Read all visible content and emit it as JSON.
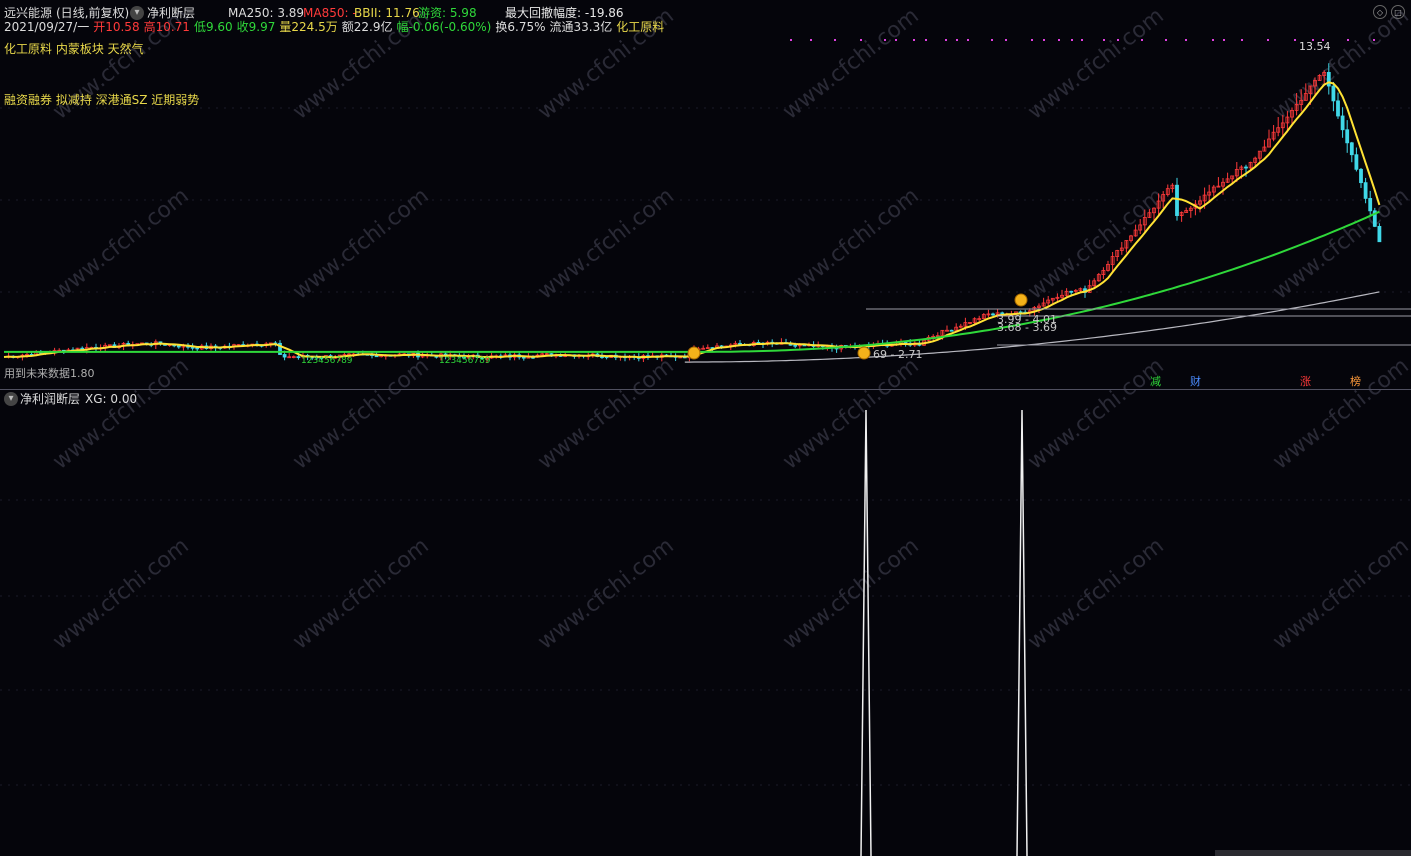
{
  "header": {
    "stock_name": "远兴能源",
    "period": "(日线,前复权)",
    "indicator_name": "净利断层",
    "ma250": "MA250: 3.89",
    "ma850": "MA850: -",
    "bbii": "BBII: 11.76",
    "youzi": "游资: 5.98",
    "max_drawdown": "最大回撤幅度: -19.86"
  },
  "info": {
    "date": "2021/09/27/一",
    "open": "开10.58",
    "high": "高10.71",
    "low": "低9.60",
    "close": "收9.97",
    "volume": "量224.5万",
    "amount": "额22.9亿",
    "change": "幅-0.06(-0.60%)",
    "turnover": "换6.75%",
    "float_cap": "流通33.3亿",
    "industry": "化工原料"
  },
  "tags": {
    "line1": "化工原料 内蒙板块 天然气",
    "line2": "融资融券 拟减持 深港通SZ 近期弱势"
  },
  "annotations": {
    "peak": "13.54",
    "level1": "3.99 - 4.01",
    "level2": "3.68 - 3.69",
    "level3": "69 - 2.71",
    "bottom_left": "用到未来数据1.80",
    "seq1": "123456789",
    "seq2": "123456789"
  },
  "flags": {
    "reduce": "减",
    "finance": "财",
    "rise": "涨",
    "rank": "榜"
  },
  "sub_panel": {
    "title": "净利润断层",
    "xg": "XG: 0.00"
  },
  "watermark": "www.cfchi.com",
  "colors": {
    "bg": "#05050b",
    "up": "#ff3a3a",
    "down": "#40d8e8",
    "ma_yellow": "#ffe234",
    "ma_green": "#2fd83a",
    "ma_gray": "#b8b8c0",
    "text_red": "#ff3a3a",
    "text_green": "#2fd83a",
    "text_yellow": "#e8d84a"
  }
}
